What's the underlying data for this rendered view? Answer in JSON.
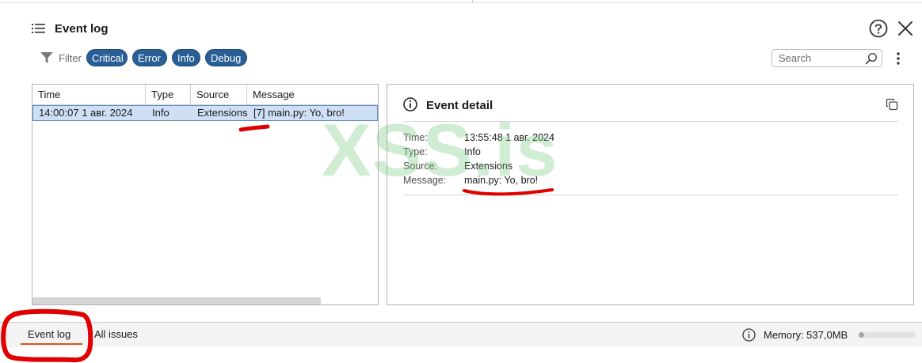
{
  "header": {
    "title": "Event log"
  },
  "filter": {
    "label": "Filter",
    "chips": [
      "Critical",
      "Error",
      "Info",
      "Debug"
    ]
  },
  "search": {
    "placeholder": "Search"
  },
  "table": {
    "columns": [
      "Time",
      "Type",
      "Source",
      "Message"
    ],
    "rows": [
      {
        "time": "14:00:07 1 авг. 2024",
        "type": "Info",
        "source": "Extensions",
        "message": "[7]  main.py: Yo, bro!"
      }
    ]
  },
  "detail": {
    "title": "Event detail",
    "fields": [
      {
        "label": "Time:",
        "value": "13:55:48 1 авг. 2024"
      },
      {
        "label": "Type:",
        "value": "Info"
      },
      {
        "label": "Source:",
        "value": "Extensions"
      },
      {
        "label": "Message:",
        "value": "main.py: Yo, bro!"
      }
    ]
  },
  "watermark": "XSS.is",
  "bottom_bar": {
    "tabs": [
      "Event log",
      "All issues"
    ],
    "memory": "Memory: 537,0MB",
    "memory_fraction": 0.1
  },
  "colors": {
    "chip_bg": "#2a5f96",
    "selected_row": "#cfe0f5",
    "active_tab_underline": "#d9531e",
    "annotation": "#e00000",
    "watermark": "#78c882"
  },
  "icons": [
    "list-icon",
    "help-icon",
    "close-icon",
    "filter-icon",
    "search-icon",
    "more-vertical-icon",
    "info-icon",
    "copy-icon"
  ]
}
